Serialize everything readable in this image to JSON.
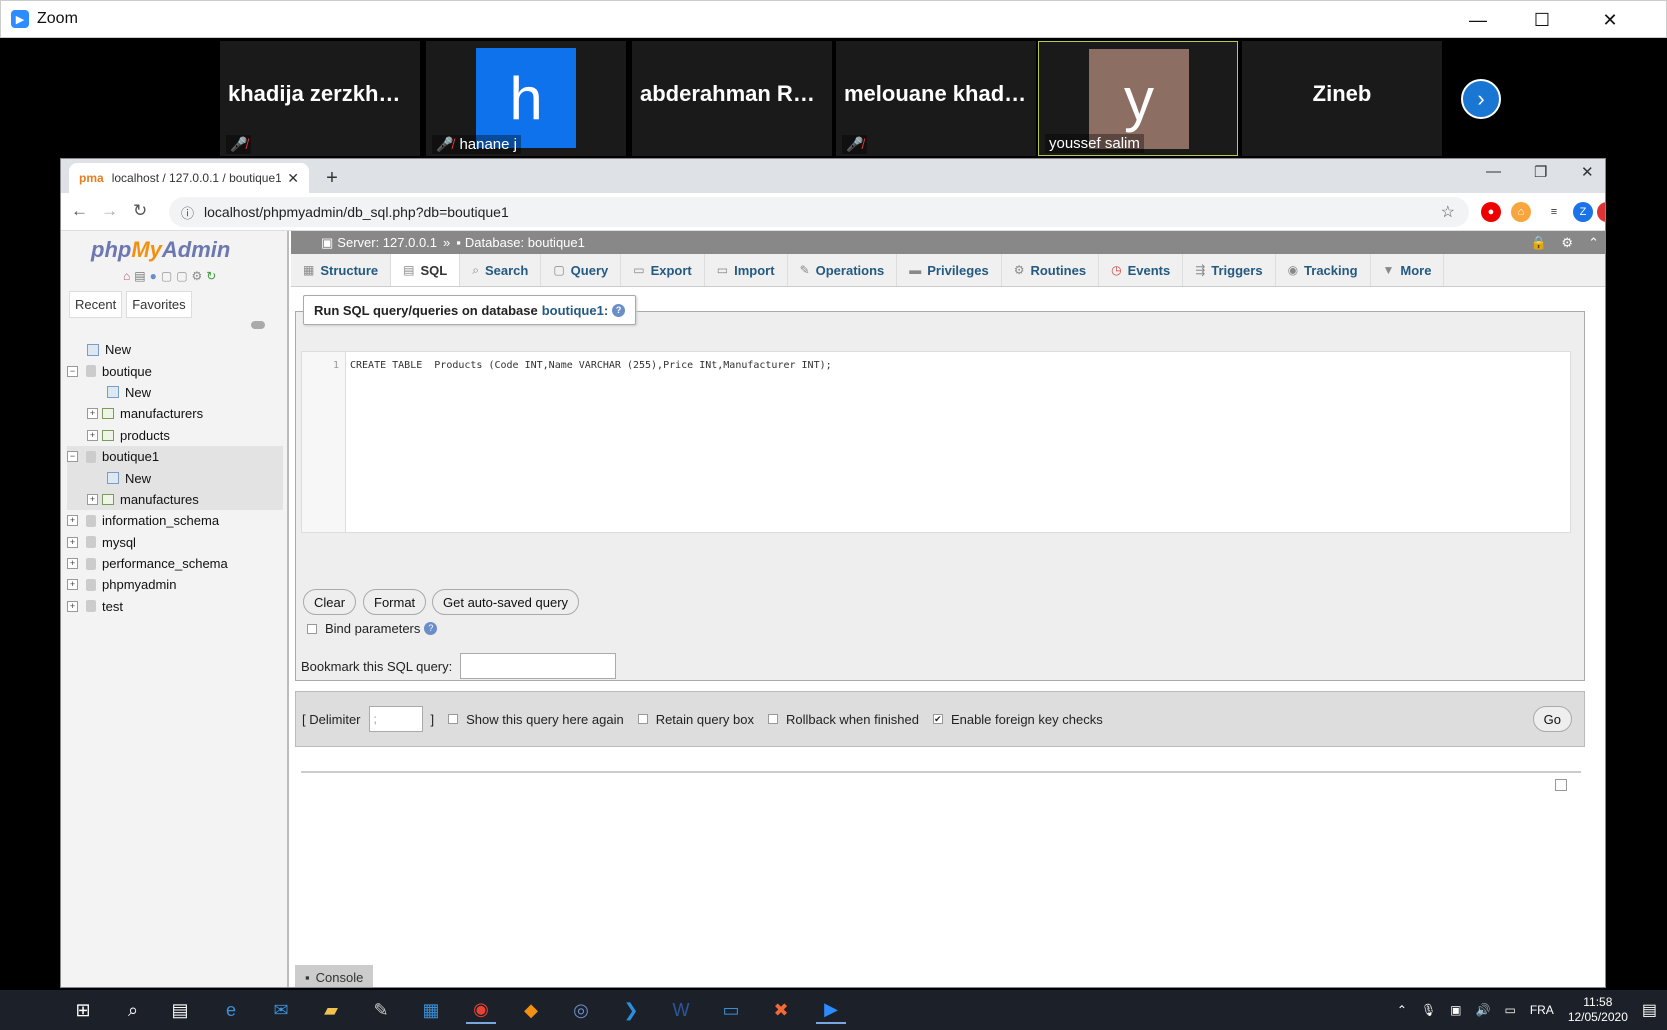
{
  "zoom": {
    "title": "Zoom",
    "participants": [
      {
        "name": "khadija zerzkhane",
        "muted": true,
        "caption": ""
      },
      {
        "name": "hanane j",
        "avatar_letter": "h",
        "avatar_color": "#0e72ed",
        "muted": true,
        "caption": "hanane j"
      },
      {
        "name": "abderahman  Ro...",
        "muted": false,
        "caption": ""
      },
      {
        "name": "melouane khadija",
        "muted": true,
        "caption": ""
      },
      {
        "name": "youssef salim",
        "avatar_letter": "y",
        "avatar_color": "#8d6e63",
        "muted": false,
        "caption": "youssef salim",
        "active_speaker": true
      },
      {
        "name": "Zineb",
        "muted": false,
        "caption": ""
      }
    ]
  },
  "browser": {
    "tab_title": "localhost / 127.0.0.1 / boutique1",
    "url": "localhost/phpmyadmin/db_sql.php?db=boutique1"
  },
  "pma": {
    "logo_php": "php",
    "logo_my": "My",
    "logo_admin": "Admin",
    "nav_tabs": [
      "Recent",
      "Favorites"
    ],
    "tree": [
      {
        "label": "New",
        "level": 0,
        "kind": "new"
      },
      {
        "label": "boutique",
        "level": 0,
        "kind": "db",
        "expanded": true
      },
      {
        "label": "New",
        "level": 1,
        "kind": "new"
      },
      {
        "label": "manufacturers",
        "level": 1,
        "kind": "table"
      },
      {
        "label": "products",
        "level": 1,
        "kind": "table"
      },
      {
        "label": "boutique1",
        "level": 0,
        "kind": "db",
        "expanded": true,
        "highlight": true
      },
      {
        "label": "New",
        "level": 1,
        "kind": "new",
        "highlight": true
      },
      {
        "label": "manufactures",
        "level": 1,
        "kind": "table",
        "highlight": true
      },
      {
        "label": "information_schema",
        "level": 0,
        "kind": "db"
      },
      {
        "label": "mysql",
        "level": 0,
        "kind": "db"
      },
      {
        "label": "performance_schema",
        "level": 0,
        "kind": "db"
      },
      {
        "label": "phpmyadmin",
        "level": 0,
        "kind": "db"
      },
      {
        "label": "test",
        "level": 0,
        "kind": "db"
      }
    ],
    "breadcrumb": {
      "server": "Server: 127.0.0.1",
      "database": "Database: boutique1"
    },
    "menu_tabs": [
      "Structure",
      "SQL",
      "Search",
      "Query",
      "Export",
      "Import",
      "Operations",
      "Privileges",
      "Routines",
      "Events",
      "Triggers",
      "Tracking",
      "More"
    ],
    "active_tab": "SQL",
    "legend_text": "Run SQL query/queries on database",
    "legend_db": "boutique1:",
    "line_number": "1",
    "query": "CREATE TABLE  Products (Code INT,Name VARCHAR (255),Price INt,Manufacturer INT);",
    "buttons": {
      "clear": "Clear",
      "format": "Format",
      "autosaved": "Get auto-saved query",
      "go": "Go"
    },
    "bind_parameters": "Bind parameters",
    "bookmark_label": "Bookmark this SQL query:",
    "delimiter_label": "[ Delimiter",
    "delimiter_value": ";",
    "delimiter_close": "]",
    "options": [
      {
        "label": "Show this query here again",
        "checked": false
      },
      {
        "label": "Retain query box",
        "checked": false
      },
      {
        "label": "Rollback when finished",
        "checked": false
      },
      {
        "label": "Enable foreign key checks",
        "checked": true
      }
    ],
    "console": "Console"
  },
  "taskbar": {
    "language": "FRA",
    "time": "11:58",
    "date": "12/05/2020"
  }
}
